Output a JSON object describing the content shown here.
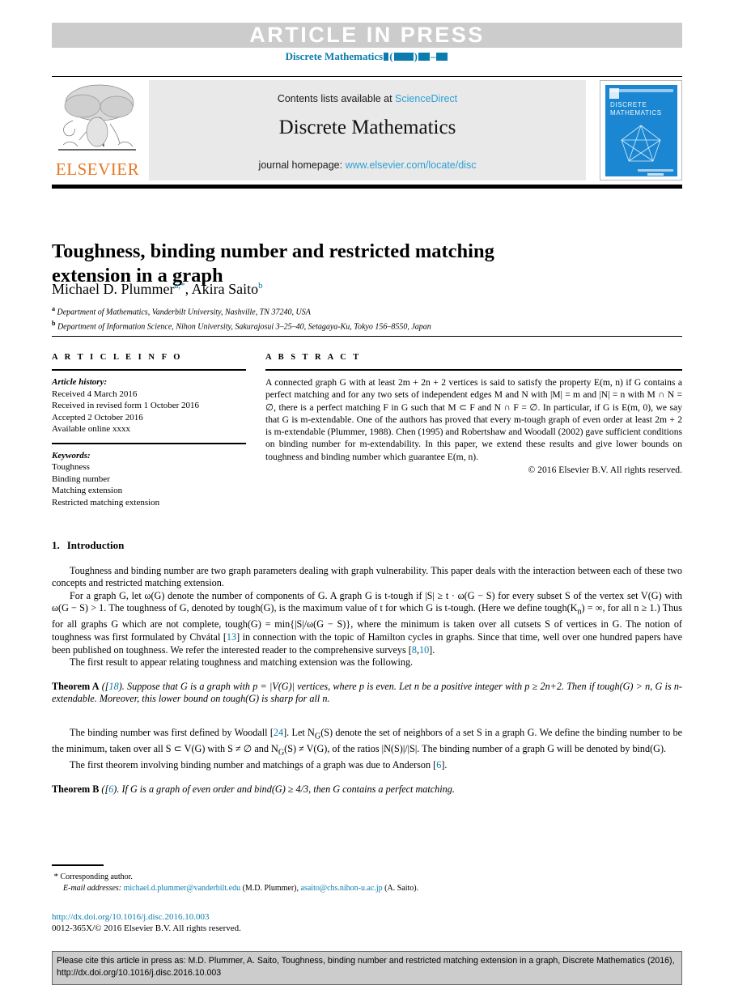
{
  "banner": {
    "article_in_press": "ARTICLE  IN  PRESS",
    "journal_running_prefix": "Discrete Mathematics"
  },
  "masthead": {
    "contents_prefix": "Contents lists available at ",
    "contents_link": "ScienceDirect",
    "journal_title": "Discrete Mathematics",
    "homepage_prefix": "journal homepage: ",
    "homepage_link": "www.elsevier.com/locate/disc",
    "publisher": "ELSEVIER",
    "cover_title_line1": "DISCRETE",
    "cover_title_line2": "MATHEMATICS"
  },
  "article": {
    "title": "Toughness, binding number and restricted matching extension in a graph",
    "authors": "Michael D. Plummer",
    "author1_sup": "a,*",
    "authors2": ", Akira Saito",
    "author2_sup": "b",
    "affiliation_a_marker": "a",
    "affiliation_a": "Department of Mathematics, Vanderbilt University, Nashville, TN 37240, USA",
    "affiliation_b_marker": "b",
    "affiliation_b": "Department of Information Science, Nihon University, Sakurajosui 3–25–40, Setagaya-Ku, Tokyo 156–8550, Japan"
  },
  "info": {
    "heading": "A R T I C L E   I N F O",
    "history_label": "Article history:",
    "history": [
      "Received 4 March 2016",
      "Received in revised form 1 October 2016",
      "Accepted 2 October 2016",
      "Available online xxxx"
    ],
    "keywords_label": "Keywords:",
    "keywords": [
      "Toughness",
      "Binding number",
      "Matching extension",
      "Restricted matching extension"
    ]
  },
  "abstract": {
    "heading": "A B S T R A C T",
    "text": "A connected graph G with at least 2m + 2n + 2 vertices is said to satisfy the property E(m, n) if G contains a perfect matching and for any two sets of independent edges M and N with |M| = m and |N| = n with M ∩ N = ∅, there is a perfect matching F in G such that M ⊂ F and N ∩ F = ∅. In particular, if G is E(m, 0), we say that G is m-extendable. One of the authors has proved that every m-tough graph of even order at least 2m + 2 is m-extendable (Plummer, 1988). Chen (1995) and Robertshaw and Woodall (2002) gave sufficient conditions on binding number for m-extendability. In this paper, we extend these results and give lower bounds on toughness and binding number which guarantee E(m, n).",
    "copyright": "© 2016 Elsevier B.V. All rights reserved."
  },
  "body": {
    "section_number": "1.",
    "section_title": "Introduction",
    "para1": "Toughness and binding number are two graph parameters dealing with graph vulnerability. This paper deals with the interaction between each of these two concepts and restricted matching extension.",
    "para2_a": "For a graph G, let ω(G) denote the number of components of G. A graph G is t-tough if |S| ≥ t · ω(G − S) for every subset S of the vertex set V(G) with ω(G − S) > 1. The toughness of G, denoted by tough(G), is the maximum value of t for which G is t-tough. (Here we define tough(K",
    "para2_sub": "n",
    "para2_b": ") = ∞, for all n ≥ 1.) Thus for all graphs G which are not complete, tough(G) = min{|S|/ω(G − S)}, where the minimum is taken over all cutsets S of vertices in G. The notion of toughness was first formulated by Chvátal [",
    "cite_13": "13",
    "para2_c": "] in connection with the topic of Hamilton cycles in graphs. Since that time, well over one hundred papers have been published on toughness. We refer the interested reader to the comprehensive surveys [",
    "cite_8": "8",
    "cite_10": "10",
    "para2_d": "].",
    "para3": "The first result to appear relating toughness and matching extension was the following.",
    "theoremA_label": "Theorem A",
    "theoremA_cite": "18",
    "theoremA_text": "). Suppose that G is a graph with p = |V(G)| vertices, where p is even. Let n be a positive integer with p ≥ 2n+2. Then if tough(G) > n, G is n-extendable. Moreover, this lower bound on tough(G) is sharp for all n.",
    "para4_a": "The binding number was first defined by Woodall [",
    "cite_24": "24",
    "para4_b": "]. Let N",
    "para4_sub": "G",
    "para4_c": "(S) denote the set of neighbors of a set S in a graph G. We define the binding number to be the minimum, taken over all S ⊂ V(G) with S ≠ ∅ and N",
    "para4_d": "(S) ≠ V(G), of the ratios |N(S)|/|S|. The binding number of a graph G will be denoted by bind(G).",
    "para5_a": "The first theorem involving binding number and matchings of a graph was due to Anderson [",
    "cite_6": "6",
    "para5_b": "].",
    "theoremB_label": "Theorem B",
    "theoremB_cite": "6",
    "theoremB_text": "). If G is a graph of even order and bind(G) ≥ 4/3, then G contains a perfect matching."
  },
  "footer": {
    "corresponding_marker": "*",
    "corresponding": "Corresponding author.",
    "email_label": "E-mail addresses:",
    "email1": "michael.d.plummer@vanderbilt.edu",
    "email1_name": "(M.D. Plummer),",
    "email2": "asaito@chs.nihon-u.ac.jp",
    "email2_name": "(A. Saito).",
    "doi": "http://dx.doi.org/10.1016/j.disc.2016.10.003",
    "issn": "0012-365X/© 2016 Elsevier B.V. All rights reserved."
  },
  "cite_box": {
    "text": "Please cite this article in press as: M.D. Plummer, A. Saito, Toughness, binding number and restricted matching extension in a graph, Discrete Mathematics (2016), http://dx.doi.org/10.1016/j.disc.2016.10.003"
  },
  "colors": {
    "link_blue": "#0b7cad",
    "sciencedirect_blue": "#2ca0d4",
    "elsevier_orange": "#e87722",
    "banner_gray": "#cccccc",
    "contents_gray": "#e9e9e9",
    "cover_blue": "#1b87d2"
  }
}
